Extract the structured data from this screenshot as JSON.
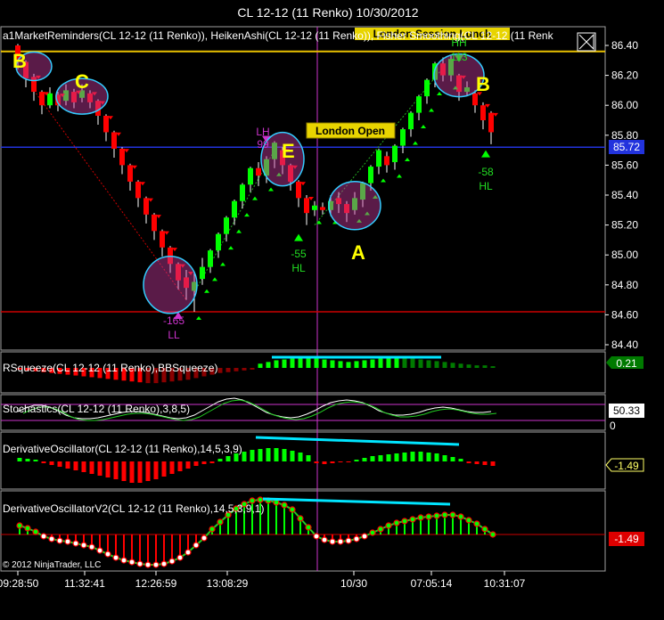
{
  "title": "CL 12-12 (11 Renko)  10/30/2012",
  "copyright": "© 2012 NinjaTrader, LLC",
  "price_panel": {
    "indicator_label": "a1MarketReminders(CL 12-12 (11 Renko)), HeikenAshi(CL 12-12 (11 Renko)), Fisher Smoothing(CL 12-12 (11 Renk",
    "ylim": [
      84.4,
      86.44
    ],
    "yticks": [
      "86.40",
      "86.20",
      "86.00",
      "85.80",
      "85.60",
      "85.40",
      "85.20",
      "85.00",
      "84.80",
      "84.60",
      "84.40"
    ],
    "current_price": "85.72",
    "session_box": "London Session Lunch",
    "open_box": "London Open",
    "level_lines": [
      {
        "price": 86.36,
        "color": "#e8c000"
      },
      {
        "price": 85.72,
        "color": "#2233dd"
      },
      {
        "price": 84.62,
        "color": "#cc0000"
      }
    ]
  },
  "chart_data": {
    "type": "candlestick",
    "candles": [
      [
        86.4,
        86.29,
        86.41,
        86.24
      ],
      [
        86.29,
        86.18,
        86.3,
        86.12
      ],
      [
        86.19,
        86.09,
        86.21,
        86.03
      ],
      [
        86.09,
        86.0,
        86.1,
        85.94
      ],
      [
        86.0,
        86.08,
        86.12,
        85.98
      ],
      [
        86.07,
        86.0,
        86.09,
        85.96
      ],
      [
        86.03,
        86.1,
        86.14,
        86.0
      ],
      [
        86.09,
        86.02,
        86.11,
        85.98
      ],
      [
        86.05,
        86.1,
        86.14,
        86.02
      ],
      [
        86.08,
        86.02,
        86.1,
        85.98
      ],
      [
        86.03,
        85.93,
        86.04,
        85.87
      ],
      [
        85.93,
        85.82,
        85.94,
        85.76
      ],
      [
        85.82,
        85.71,
        85.83,
        85.65
      ],
      [
        85.71,
        85.6,
        85.72,
        85.54
      ],
      [
        85.6,
        85.49,
        85.61,
        85.43
      ],
      [
        85.49,
        85.38,
        85.5,
        85.32
      ],
      [
        85.38,
        85.27,
        85.39,
        85.21
      ],
      [
        85.27,
        85.16,
        85.28,
        85.1
      ],
      [
        85.16,
        85.05,
        85.17,
        84.99
      ],
      [
        85.05,
        84.94,
        85.06,
        84.88
      ],
      [
        84.94,
        84.83,
        84.95,
        84.77
      ],
      [
        84.85,
        84.78,
        84.9,
        84.7
      ],
      [
        84.76,
        84.82,
        84.88,
        84.62
      ],
      [
        84.84,
        84.92,
        84.98,
        84.8
      ],
      [
        84.92,
        85.03,
        85.04,
        84.88
      ],
      [
        85.03,
        85.14,
        85.15,
        84.98
      ],
      [
        85.14,
        85.25,
        85.26,
        85.09
      ],
      [
        85.25,
        85.36,
        85.37,
        85.2
      ],
      [
        85.36,
        85.47,
        85.48,
        85.31
      ],
      [
        85.47,
        85.58,
        85.59,
        85.42
      ],
      [
        85.58,
        85.53,
        85.62,
        85.46
      ],
      [
        85.53,
        85.64,
        85.66,
        85.48
      ],
      [
        85.64,
        85.75,
        85.76,
        85.58
      ],
      [
        85.7,
        85.6,
        85.72,
        85.54
      ],
      [
        85.6,
        85.49,
        85.61,
        85.43
      ],
      [
        85.49,
        85.38,
        85.5,
        85.32
      ],
      [
        85.38,
        85.28,
        85.4,
        85.2
      ],
      [
        85.3,
        85.33,
        85.36,
        85.26
      ],
      [
        85.32,
        85.3,
        85.35,
        85.27
      ],
      [
        85.3,
        85.36,
        85.4,
        85.26
      ],
      [
        85.38,
        85.34,
        85.42,
        85.28
      ],
      [
        85.34,
        85.28,
        85.36,
        85.22
      ],
      [
        85.3,
        85.38,
        85.42,
        85.27
      ],
      [
        85.37,
        85.48,
        85.49,
        85.32
      ],
      [
        85.48,
        85.59,
        85.6,
        85.43
      ],
      [
        85.59,
        85.7,
        85.71,
        85.54
      ],
      [
        85.66,
        85.6,
        85.69,
        85.55
      ],
      [
        85.62,
        85.73,
        85.74,
        85.57
      ],
      [
        85.73,
        85.84,
        85.85,
        85.68
      ],
      [
        85.84,
        85.95,
        85.96,
        85.79
      ],
      [
        85.95,
        86.06,
        86.07,
        85.9
      ],
      [
        86.06,
        86.17,
        86.18,
        86.01
      ],
      [
        86.17,
        86.28,
        86.29,
        86.12
      ],
      [
        86.28,
        86.2,
        86.32,
        86.16
      ],
      [
        86.2,
        86.31,
        86.33,
        86.16
      ],
      [
        86.2,
        86.09,
        86.21,
        86.03
      ],
      [
        86.09,
        86.12,
        86.16,
        86.06
      ],
      [
        86.08,
        86.0,
        86.1,
        85.95
      ],
      [
        86.0,
        85.9,
        86.02,
        85.84
      ],
      [
        85.95,
        85.82,
        85.96,
        85.74
      ]
    ],
    "x_labels": [
      "09:28:50",
      "11:32:41",
      "12:26:59",
      "13:08:29",
      "10/30",
      "07:05:14",
      "10:31:07"
    ]
  },
  "annotations": {
    "B_left": "B",
    "C": "C",
    "E": "E",
    "A": "A",
    "B_right": "B",
    "ll_value": "-165",
    "ll_label": "LL",
    "lh_label": "LH",
    "lh_value": "99",
    "hl1_value": "-55",
    "hl1_label": "HL",
    "hh_label": "HH",
    "hh_value": "113",
    "hl2_value": "-58",
    "hl2_label": "HL"
  },
  "panels": {
    "squeeze": {
      "label": "RSqueeze(CL 12-12 (11 Renko),BBSqueeze)",
      "value": "0.21"
    },
    "stoch": {
      "label": "Stochastics(CL 12-12 (11 Renko),3,8,5)",
      "value": "50.33",
      "tick_zero": "0"
    },
    "deriv": {
      "label": "DerivativeOscillator(CL 12-12 (11 Renko),14,5,3,9)",
      "value": "-1.49"
    },
    "deriv2": {
      "label": "DerivativeOscillatorV2(CL 12-12 (11 Renko),14,5,3,9,1)",
      "value": "-1.49"
    }
  },
  "colors": {
    "up": "#00ff00",
    "down": "#ff0000",
    "cyan": "#00e5ff",
    "yellow": "#ffff00",
    "magenta": "#cc00cc"
  }
}
